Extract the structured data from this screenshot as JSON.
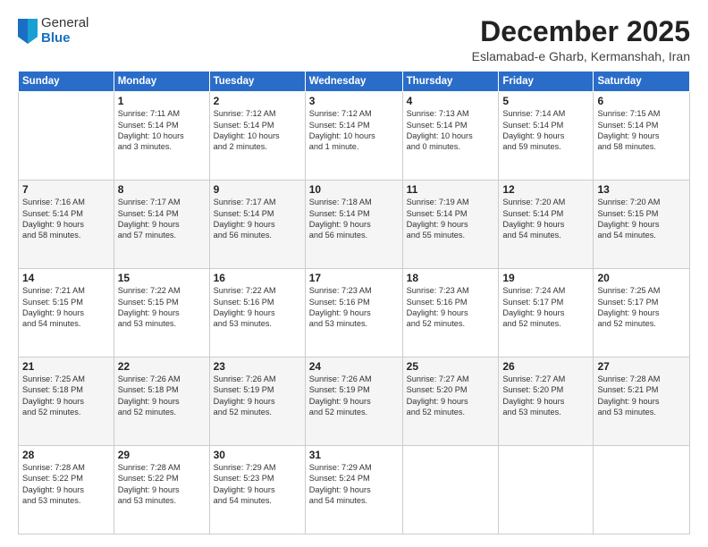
{
  "logo": {
    "general": "General",
    "blue": "Blue"
  },
  "header": {
    "month": "December 2025",
    "location": "Eslamabad-e Gharb, Kermanshah, Iran"
  },
  "days_of_week": [
    "Sunday",
    "Monday",
    "Tuesday",
    "Wednesday",
    "Thursday",
    "Friday",
    "Saturday"
  ],
  "weeks": [
    [
      {
        "day": "",
        "info": ""
      },
      {
        "day": "1",
        "info": "Sunrise: 7:11 AM\nSunset: 5:14 PM\nDaylight: 10 hours\nand 3 minutes."
      },
      {
        "day": "2",
        "info": "Sunrise: 7:12 AM\nSunset: 5:14 PM\nDaylight: 10 hours\nand 2 minutes."
      },
      {
        "day": "3",
        "info": "Sunrise: 7:12 AM\nSunset: 5:14 PM\nDaylight: 10 hours\nand 1 minute."
      },
      {
        "day": "4",
        "info": "Sunrise: 7:13 AM\nSunset: 5:14 PM\nDaylight: 10 hours\nand 0 minutes."
      },
      {
        "day": "5",
        "info": "Sunrise: 7:14 AM\nSunset: 5:14 PM\nDaylight: 9 hours\nand 59 minutes."
      },
      {
        "day": "6",
        "info": "Sunrise: 7:15 AM\nSunset: 5:14 PM\nDaylight: 9 hours\nand 58 minutes."
      }
    ],
    [
      {
        "day": "7",
        "info": "Sunrise: 7:16 AM\nSunset: 5:14 PM\nDaylight: 9 hours\nand 58 minutes."
      },
      {
        "day": "8",
        "info": "Sunrise: 7:17 AM\nSunset: 5:14 PM\nDaylight: 9 hours\nand 57 minutes."
      },
      {
        "day": "9",
        "info": "Sunrise: 7:17 AM\nSunset: 5:14 PM\nDaylight: 9 hours\nand 56 minutes."
      },
      {
        "day": "10",
        "info": "Sunrise: 7:18 AM\nSunset: 5:14 PM\nDaylight: 9 hours\nand 56 minutes."
      },
      {
        "day": "11",
        "info": "Sunrise: 7:19 AM\nSunset: 5:14 PM\nDaylight: 9 hours\nand 55 minutes."
      },
      {
        "day": "12",
        "info": "Sunrise: 7:20 AM\nSunset: 5:14 PM\nDaylight: 9 hours\nand 54 minutes."
      },
      {
        "day": "13",
        "info": "Sunrise: 7:20 AM\nSunset: 5:15 PM\nDaylight: 9 hours\nand 54 minutes."
      }
    ],
    [
      {
        "day": "14",
        "info": "Sunrise: 7:21 AM\nSunset: 5:15 PM\nDaylight: 9 hours\nand 54 minutes."
      },
      {
        "day": "15",
        "info": "Sunrise: 7:22 AM\nSunset: 5:15 PM\nDaylight: 9 hours\nand 53 minutes."
      },
      {
        "day": "16",
        "info": "Sunrise: 7:22 AM\nSunset: 5:16 PM\nDaylight: 9 hours\nand 53 minutes."
      },
      {
        "day": "17",
        "info": "Sunrise: 7:23 AM\nSunset: 5:16 PM\nDaylight: 9 hours\nand 53 minutes."
      },
      {
        "day": "18",
        "info": "Sunrise: 7:23 AM\nSunset: 5:16 PM\nDaylight: 9 hours\nand 52 minutes."
      },
      {
        "day": "19",
        "info": "Sunrise: 7:24 AM\nSunset: 5:17 PM\nDaylight: 9 hours\nand 52 minutes."
      },
      {
        "day": "20",
        "info": "Sunrise: 7:25 AM\nSunset: 5:17 PM\nDaylight: 9 hours\nand 52 minutes."
      }
    ],
    [
      {
        "day": "21",
        "info": "Sunrise: 7:25 AM\nSunset: 5:18 PM\nDaylight: 9 hours\nand 52 minutes."
      },
      {
        "day": "22",
        "info": "Sunrise: 7:26 AM\nSunset: 5:18 PM\nDaylight: 9 hours\nand 52 minutes."
      },
      {
        "day": "23",
        "info": "Sunrise: 7:26 AM\nSunset: 5:19 PM\nDaylight: 9 hours\nand 52 minutes."
      },
      {
        "day": "24",
        "info": "Sunrise: 7:26 AM\nSunset: 5:19 PM\nDaylight: 9 hours\nand 52 minutes."
      },
      {
        "day": "25",
        "info": "Sunrise: 7:27 AM\nSunset: 5:20 PM\nDaylight: 9 hours\nand 52 minutes."
      },
      {
        "day": "26",
        "info": "Sunrise: 7:27 AM\nSunset: 5:20 PM\nDaylight: 9 hours\nand 53 minutes."
      },
      {
        "day": "27",
        "info": "Sunrise: 7:28 AM\nSunset: 5:21 PM\nDaylight: 9 hours\nand 53 minutes."
      }
    ],
    [
      {
        "day": "28",
        "info": "Sunrise: 7:28 AM\nSunset: 5:22 PM\nDaylight: 9 hours\nand 53 minutes."
      },
      {
        "day": "29",
        "info": "Sunrise: 7:28 AM\nSunset: 5:22 PM\nDaylight: 9 hours\nand 53 minutes."
      },
      {
        "day": "30",
        "info": "Sunrise: 7:29 AM\nSunset: 5:23 PM\nDaylight: 9 hours\nand 54 minutes."
      },
      {
        "day": "31",
        "info": "Sunrise: 7:29 AM\nSunset: 5:24 PM\nDaylight: 9 hours\nand 54 minutes."
      },
      {
        "day": "",
        "info": ""
      },
      {
        "day": "",
        "info": ""
      },
      {
        "day": "",
        "info": ""
      }
    ]
  ]
}
